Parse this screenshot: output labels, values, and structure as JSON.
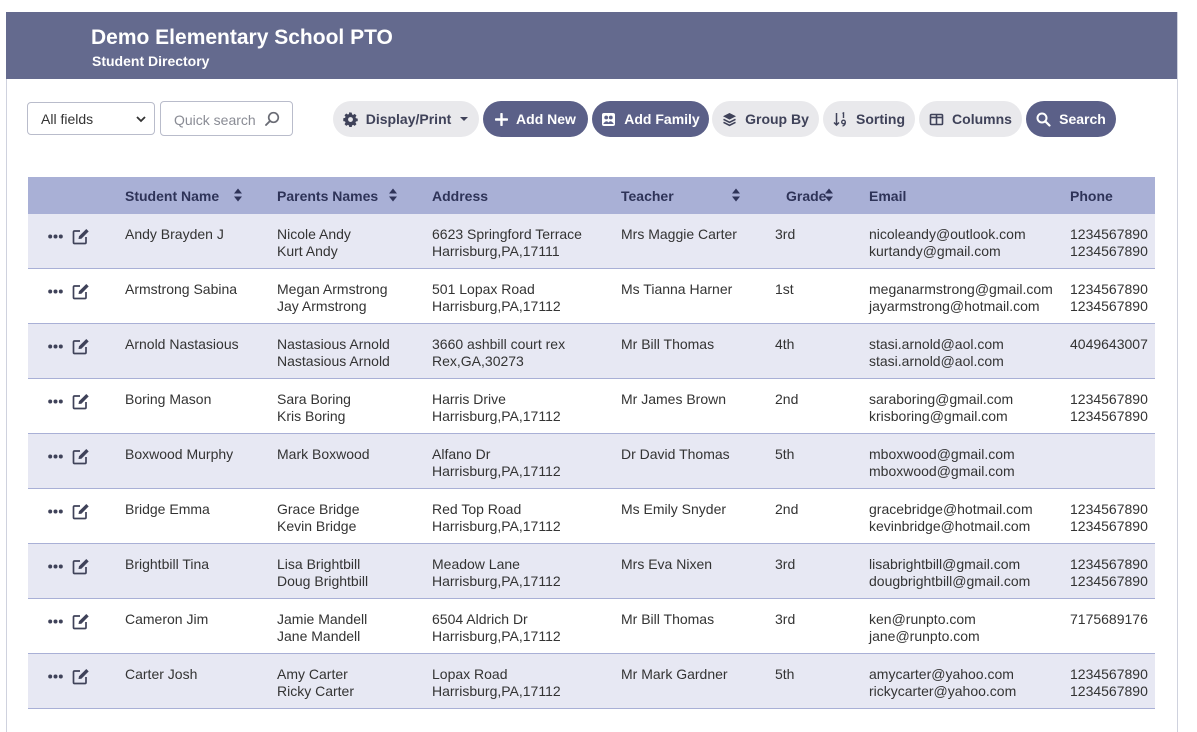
{
  "header": {
    "title": "Demo Elementary School PTO",
    "subtitle": "Student Directory"
  },
  "toolbar": {
    "field_select": "All fields",
    "search_placeholder": "Quick search",
    "display_print": "Display/Print",
    "add_new": "Add New",
    "add_family": "Add Family",
    "group_by": "Group By",
    "sorting": "Sorting",
    "columns": "Columns",
    "search": "Search"
  },
  "columns": {
    "student": "Student Name",
    "parents": "Parents Names",
    "address": "Address",
    "teacher": "Teacher",
    "grade": "Grade",
    "email": "Email",
    "phone": "Phone"
  },
  "colors": {
    "header_bg": "#646a8e",
    "table_header_bg": "#a9b0d6",
    "row_alt_bg": "#e7e8f3",
    "dark_button": "#5b6088",
    "light_button": "#e9e9ec"
  },
  "rows": [
    {
      "student": "Andy Brayden J",
      "parent1": "Nicole Andy",
      "parent2": "Kurt Andy",
      "addr1": "6623 Springford Terrace",
      "addr2": "Harrisburg,PA,17111",
      "teacher": "Mrs Maggie Carter",
      "grade": "3rd",
      "email1": "nicoleandy@outlook.com",
      "email2": "kurtandy@gmail.com",
      "phone1": "1234567890",
      "phone2": "1234567890"
    },
    {
      "student": "Armstrong Sabina",
      "parent1": "Megan Armstrong",
      "parent2": "Jay Armstrong",
      "addr1": "501 Lopax Road",
      "addr2": "Harrisburg,PA,17112",
      "teacher": "Ms Tianna Harner",
      "grade": "1st",
      "email1": "meganarmstrong@gmail.com",
      "email2": "jayarmstrong@hotmail.com",
      "phone1": "1234567890",
      "phone2": "1234567890"
    },
    {
      "student": "Arnold Nastasious",
      "parent1": "Nastasious Arnold",
      "parent2": "Nastasious Arnold",
      "addr1": "3660 ashbill court rex",
      "addr2": "Rex,GA,30273",
      "teacher": "Mr Bill Thomas",
      "grade": "4th",
      "email1": "stasi.arnold@aol.com",
      "email2": "stasi.arnold@aol.com",
      "phone1": "4049643007",
      "phone2": ""
    },
    {
      "student": "Boring Mason",
      "parent1": "Sara Boring",
      "parent2": "Kris Boring",
      "addr1": "Harris Drive",
      "addr2": "Harrisburg,PA,17112",
      "teacher": "Mr James Brown",
      "grade": "2nd",
      "email1": "saraboring@gmail.com",
      "email2": "krisboring@gmail.com",
      "phone1": "1234567890",
      "phone2": "1234567890"
    },
    {
      "student": "Boxwood Murphy",
      "parent1": "Mark Boxwood",
      "parent2": "",
      "addr1": "Alfano Dr",
      "addr2": "Harrisburg,PA,17112",
      "teacher": "Dr David Thomas",
      "grade": "5th",
      "email1": "mboxwood@gmail.com",
      "email2": "mboxwood@gmail.com",
      "phone1": "",
      "phone2": ""
    },
    {
      "student": "Bridge Emma",
      "parent1": "Grace Bridge",
      "parent2": "Kevin Bridge",
      "addr1": "Red Top Road",
      "addr2": "Harrisburg,PA,17112",
      "teacher": "Ms Emily Snyder",
      "grade": "2nd",
      "email1": "gracebridge@hotmail.com",
      "email2": "kevinbridge@hotmail.com",
      "phone1": "1234567890",
      "phone2": "1234567890"
    },
    {
      "student": "Brightbill Tina",
      "parent1": "Lisa Brightbill",
      "parent2": "Doug Brightbill",
      "addr1": "Meadow Lane",
      "addr2": "Harrisburg,PA,17112",
      "teacher": "Mrs Eva Nixen",
      "grade": "3rd",
      "email1": "lisabrightbill@gmail.com",
      "email2": "dougbrightbill@gmail.com",
      "phone1": "1234567890",
      "phone2": "1234567890"
    },
    {
      "student": "Cameron Jim",
      "parent1": "Jamie Mandell",
      "parent2": "Jane Mandell",
      "addr1": "6504 Aldrich Dr",
      "addr2": "Harrisburg,PA,17112",
      "teacher": "Mr Bill Thomas",
      "grade": "3rd",
      "email1": "ken@runpto.com",
      "email2": "jane@runpto.com",
      "phone1": "7175689176",
      "phone2": ""
    },
    {
      "student": "Carter Josh",
      "parent1": "Amy Carter",
      "parent2": "Ricky Carter",
      "addr1": "Lopax Road",
      "addr2": "Harrisburg,PA,17112",
      "teacher": "Mr Mark Gardner",
      "grade": "5th",
      "email1": "amycarter@yahoo.com",
      "email2": "rickycarter@yahoo.com",
      "phone1": "1234567890",
      "phone2": "1234567890"
    }
  ]
}
